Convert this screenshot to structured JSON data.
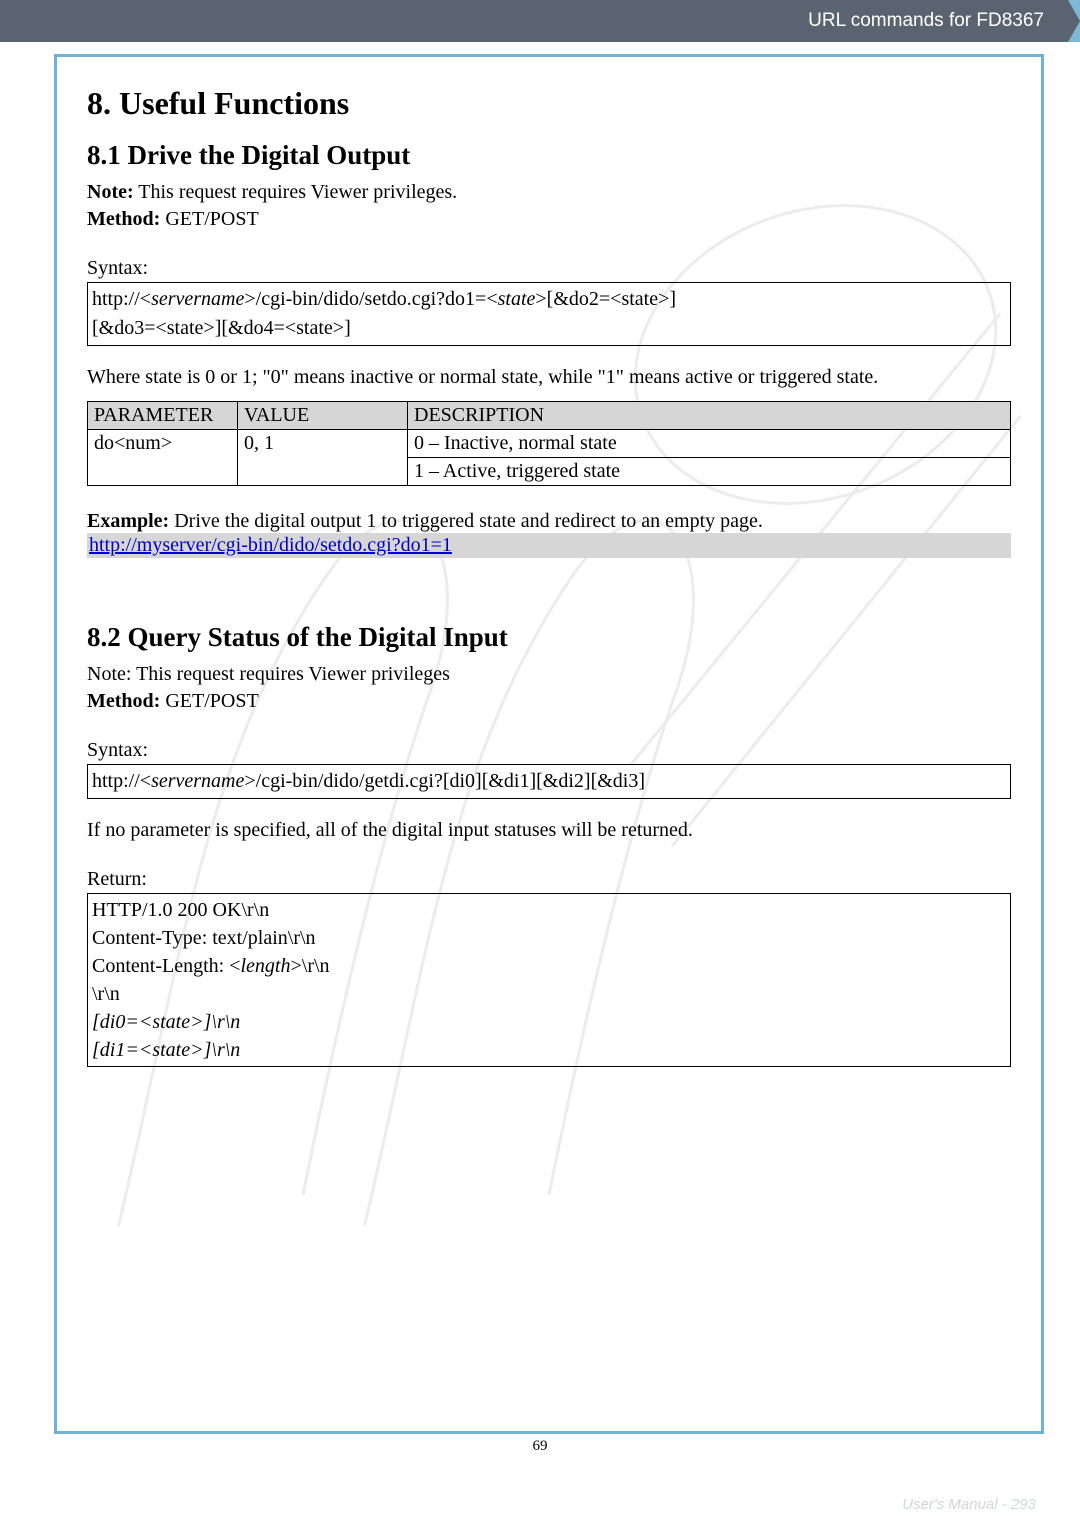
{
  "header": {
    "breadcrumb": "URL commands for FD8367"
  },
  "h1": "8. Useful Functions",
  "s81": {
    "title": "8.1 Drive the Digital Output",
    "note_label": "Note:",
    "note_text": " This request requires Viewer privileges.",
    "method_label": "Method:",
    "method_value": " GET/POST",
    "syntax_label": "Syntax:",
    "syntax_line1_pre": "http://<",
    "syntax_line1_srv": "servername",
    "syntax_line1_mid": ">/cgi-bin/dido/setdo.cgi?do1=<",
    "syntax_line1_state": "state",
    "syntax_line1_post": ">[&do2=<state>]",
    "syntax_line2": "[&do3=<state>][&do4=<state>]",
    "where_text": "Where state is 0 or 1; \"0\" means inactive or normal state, while \"1\" means active or triggered state.",
    "table": {
      "headers": [
        "PARAMETER",
        "VALUE",
        "DESCRIPTION"
      ],
      "row": {
        "param": "do<num>",
        "value": "0, 1",
        "desc1": "0 – Inactive, normal state",
        "desc2": "1 – Active, triggered state"
      }
    },
    "example_label": "Example:",
    "example_text": " Drive the digital output 1 to triggered state and redirect to an empty page.",
    "example_link": "http://myserver/cgi-bin/dido/setdo.cgi?do1=1"
  },
  "s82": {
    "title": "8.2 Query Status of the Digital Input",
    "note_text": "Note: This request requires Viewer privileges",
    "method_label": "Method:",
    "method_value": " GET/POST",
    "syntax_label": "Syntax:",
    "syntax_line_pre": "http://<",
    "syntax_line_srv": "servername",
    "syntax_line_post": ">/cgi-bin/dido/getdi.cgi?[di0][&di1][&di2][&di3]",
    "if_text": "If no parameter is specified, all of the digital input statuses will be returned.",
    "return_label": "Return:",
    "return_lines": {
      "l1": "HTTP/1.0 200 OK\\r\\n",
      "l2": "Content-Type: text/plain\\r\\n",
      "l3_pre": "Content-Length: <",
      "l3_len": "length",
      "l3_post": ">\\r\\n",
      "l4": "\\r\\n",
      "l5": "[di0=<state>]\\r\\n",
      "l6": "[di1=<state>]\\r\\n"
    }
  },
  "footer": {
    "pagenum": "69",
    "right": "User's Manual - 293"
  }
}
